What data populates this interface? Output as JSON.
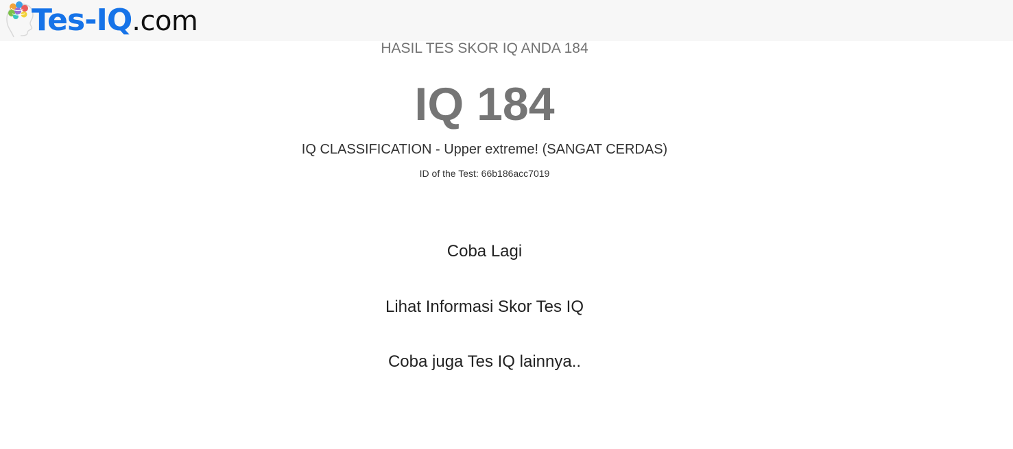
{
  "header": {
    "logo_main": "Tes-IQ",
    "logo_ext": ".com",
    "logo_icon": "brain-head-icon"
  },
  "result": {
    "subtitle": "HASIL TES SKOR IQ ANDA 184",
    "score": "IQ 184",
    "classification": "IQ CLASSIFICATION - Upper extreme! (SANGAT CERDAS)",
    "test_id": "ID of the Test: 66b186acc7019"
  },
  "links": {
    "retry": "Coba Lagi",
    "info": "Lihat Informasi Skor Tes IQ",
    "more": "Coba juga Tes IQ lainnya.."
  },
  "colors": {
    "logo_blue": "#1673e8",
    "header_bg": "#f7f7f7",
    "score_gray": "#757575"
  }
}
